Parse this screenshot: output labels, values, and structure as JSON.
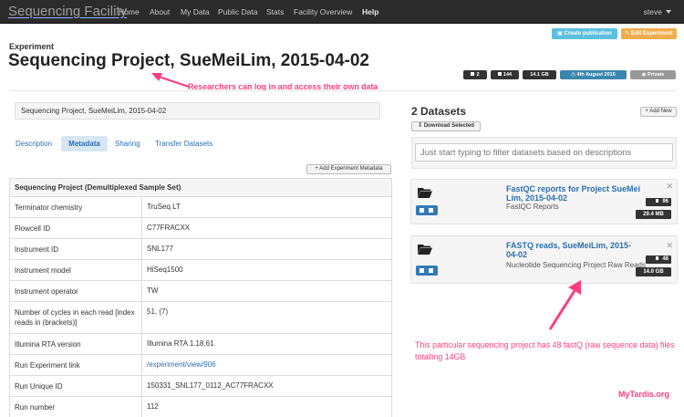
{
  "navbar": {
    "brand": "Sequencing Facility",
    "links": [
      "Home",
      "About",
      "My Data",
      "Public Data",
      "Stats",
      "Facility Overview",
      "Help"
    ],
    "user": "steve"
  },
  "header": {
    "label": "Experiment",
    "title": "Sequencing Project, SueMeiLim, 2015-04-02",
    "create_publication": "Create publication",
    "edit_experiment": "Edit Experiment",
    "badges": {
      "datasets": "2",
      "files": "144",
      "size": "14.1 GB",
      "date": "4th August 2015",
      "visibility": "Private"
    }
  },
  "annotations": {
    "top": "Researchers can log in and access their own data",
    "bottom": "This particular sequencing project has 48 fastQ (raw sequence data) files totalling 14GB",
    "brand": "MyTardis.org"
  },
  "description_box": "Sequencing Project, SueMeiLim, 2015-04-02",
  "tabs": [
    "Description",
    "Metadata",
    "Sharing",
    "Transfer Datasets"
  ],
  "add_metadata_label": "Add Experiment Metadata",
  "metadata": {
    "heading": "Sequencing Project (Demultiplexed Sample Set)",
    "rows": [
      {
        "key": "Terminator chemistry",
        "value": "TruSeq LT"
      },
      {
        "key": "Flowcell ID",
        "value": "C77FRACXX"
      },
      {
        "key": "Instrument ID",
        "value": "SNL177"
      },
      {
        "key": "Instrument model",
        "value": "HiSeq1500"
      },
      {
        "key": "Instrument operator",
        "value": "TW"
      },
      {
        "key": "Number of cycles in each read [index reads in (brackets)]",
        "value": "51, (7)"
      },
      {
        "key": "Illumina RTA version",
        "value": "Illumina RTA 1.18.61"
      },
      {
        "key": "Run Experiment link",
        "value": "/experiment/view/906"
      },
      {
        "key": "Run Unique ID",
        "value": "150331_SNL177_0112_AC77FRACXX"
      },
      {
        "key": "Run number",
        "value": "112"
      }
    ]
  },
  "datasets": {
    "title": "2 Datasets",
    "download_selected": "Download Selected",
    "add_new": "Add New",
    "filter_placeholder": "Just start typing to filter datasets based on descriptions",
    "items": [
      {
        "name": "FastQC reports for Project SueMei Lim, 2015-04-02",
        "description": "FastQC Reports",
        "count": "96",
        "size": "29.4 MB"
      },
      {
        "name": "FASTQ reads, SueMeiLim, 2015-04-02",
        "description": "Nucleotide Sequencing Project Raw Reads",
        "count": "48",
        "size": "14.0 GB"
      }
    ]
  },
  "colors": {
    "navbar": "#2b2b2b",
    "link": "#2a6fb0",
    "annotation": "#ff3d7f",
    "info_button": "#5bc0de",
    "warning_button": "#f0ad4e",
    "primary_button": "#337ab7"
  }
}
